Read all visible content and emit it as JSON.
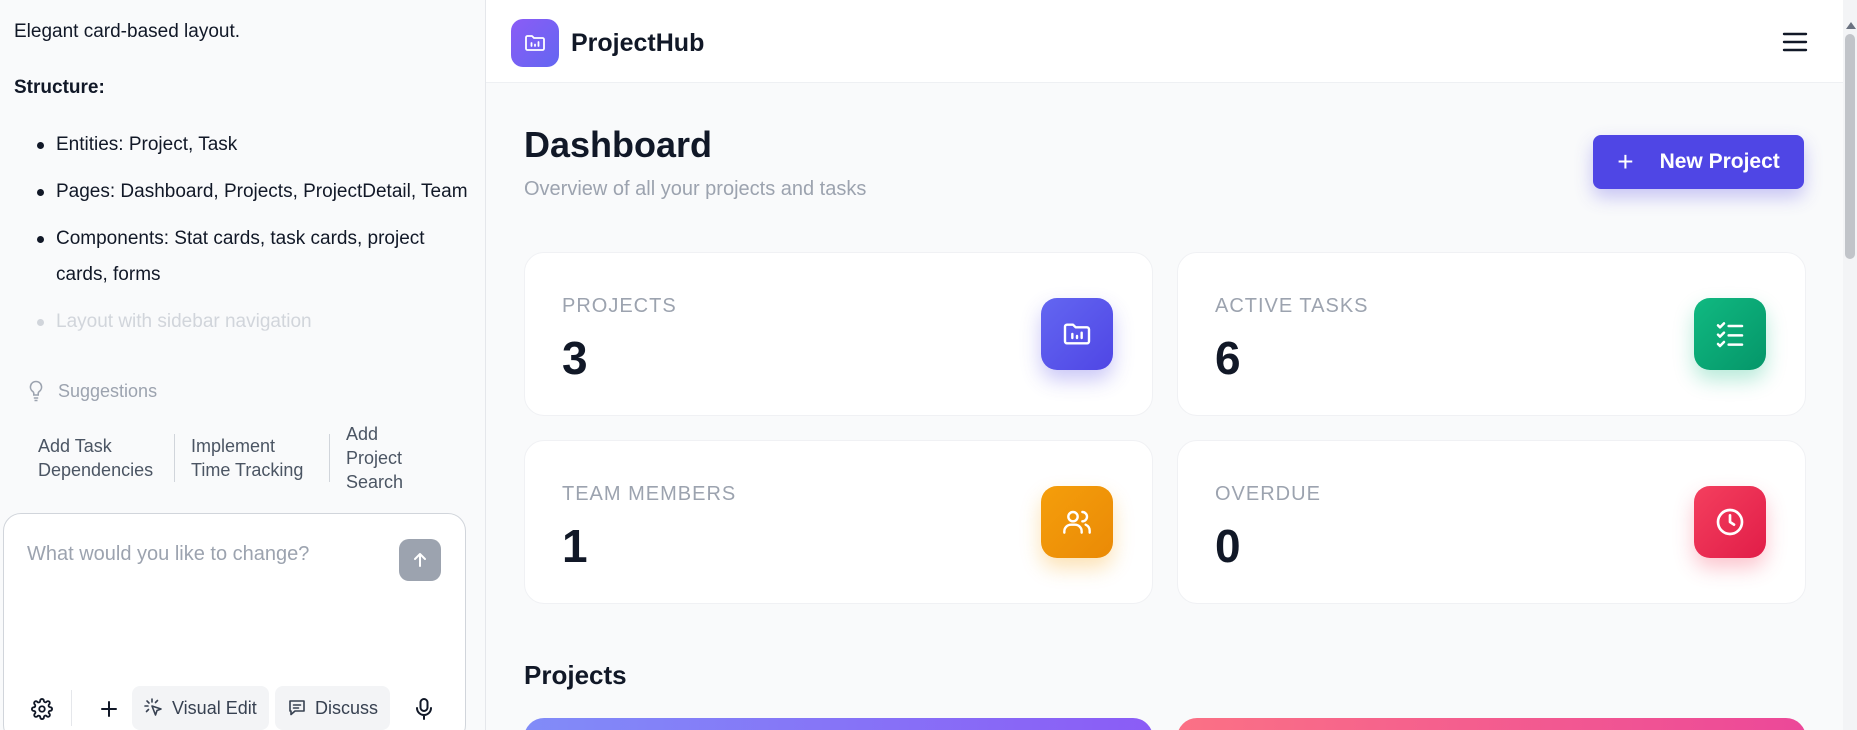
{
  "chat": {
    "intro": "Elegant card-based layout.",
    "structure_heading": "Structure:",
    "bullets": [
      "Entities: Project, Task",
      "Pages: Dashboard, Projects, ProjectDetail, Team",
      "Components: Stat cards, task cards, project cards, forms",
      "Layout with sidebar navigation"
    ],
    "suggestions_label": "Suggestions",
    "suggestions": [
      "Add Task Dependencies",
      "Implement Time Tracking",
      "Add Project Search"
    ],
    "input_placeholder": "What would you like to change?",
    "tools": {
      "visual_edit": "Visual Edit",
      "discuss": "Discuss"
    }
  },
  "app": {
    "brand": "ProjectHub",
    "page_title": "Dashboard",
    "page_subtitle": "Overview of all your projects and tasks",
    "new_project_label": "New Project",
    "stats": [
      {
        "label": "PROJECTS",
        "value": "3",
        "icon": "folder-chart-icon",
        "color": "#4f46e5"
      },
      {
        "label": "ACTIVE TASKS",
        "value": "6",
        "icon": "checklist-icon",
        "color": "#10b981"
      },
      {
        "label": "TEAM MEMBERS",
        "value": "1",
        "icon": "users-icon",
        "color": "#f59e0b"
      },
      {
        "label": "OVERDUE",
        "value": "0",
        "icon": "clock-icon",
        "color": "#e11d48"
      }
    ],
    "projects_heading": "Projects"
  }
}
